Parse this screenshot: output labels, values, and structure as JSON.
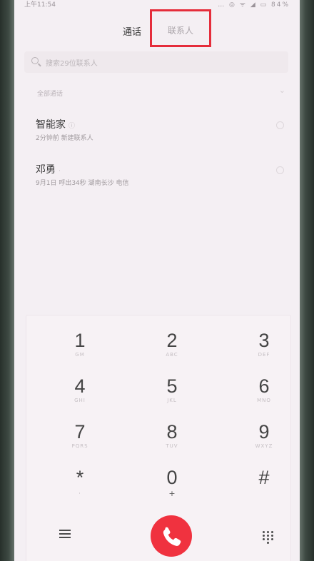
{
  "status_bar": {
    "time": "上午11:54",
    "icons": "… ◎ ᯤ ◢ ▭ 84%",
    "battery": "84%"
  },
  "tabs": {
    "calls": "通话",
    "contacts": "联系人"
  },
  "search": {
    "placeholder": "搜索29位联系人"
  },
  "section": {
    "label": "全部通话"
  },
  "calls": [
    {
      "name": "智能家",
      "tag": "ⓘ",
      "meta": "2分钟前 新建联系人"
    },
    {
      "name": "邓勇",
      "tag": "·",
      "meta": "9月1日 呼出34秒 湖南长沙 电信"
    }
  ],
  "dialpad": {
    "keys": [
      {
        "digit": "1",
        "letters": "GM"
      },
      {
        "digit": "2",
        "letters": "ABC"
      },
      {
        "digit": "3",
        "letters": "DEF"
      },
      {
        "digit": "4",
        "letters": "GHI"
      },
      {
        "digit": "5",
        "letters": "JKL"
      },
      {
        "digit": "6",
        "letters": "MNO"
      },
      {
        "digit": "7",
        "letters": "PQRS"
      },
      {
        "digit": "8",
        "letters": "TUV"
      },
      {
        "digit": "9",
        "letters": "WXYZ"
      },
      {
        "digit": "*",
        "letters": ","
      },
      {
        "digit": "0",
        "letters": "+"
      },
      {
        "digit": "#",
        "letters": ""
      }
    ]
  },
  "icons": {
    "menu": "menu-icon",
    "call": "phone-icon",
    "keypad": "keypad-icon",
    "search": "search-icon"
  },
  "colors": {
    "accent_red": "#f0323f",
    "highlight_box": "#e52d3b",
    "screen_background": "#f4eff3"
  }
}
